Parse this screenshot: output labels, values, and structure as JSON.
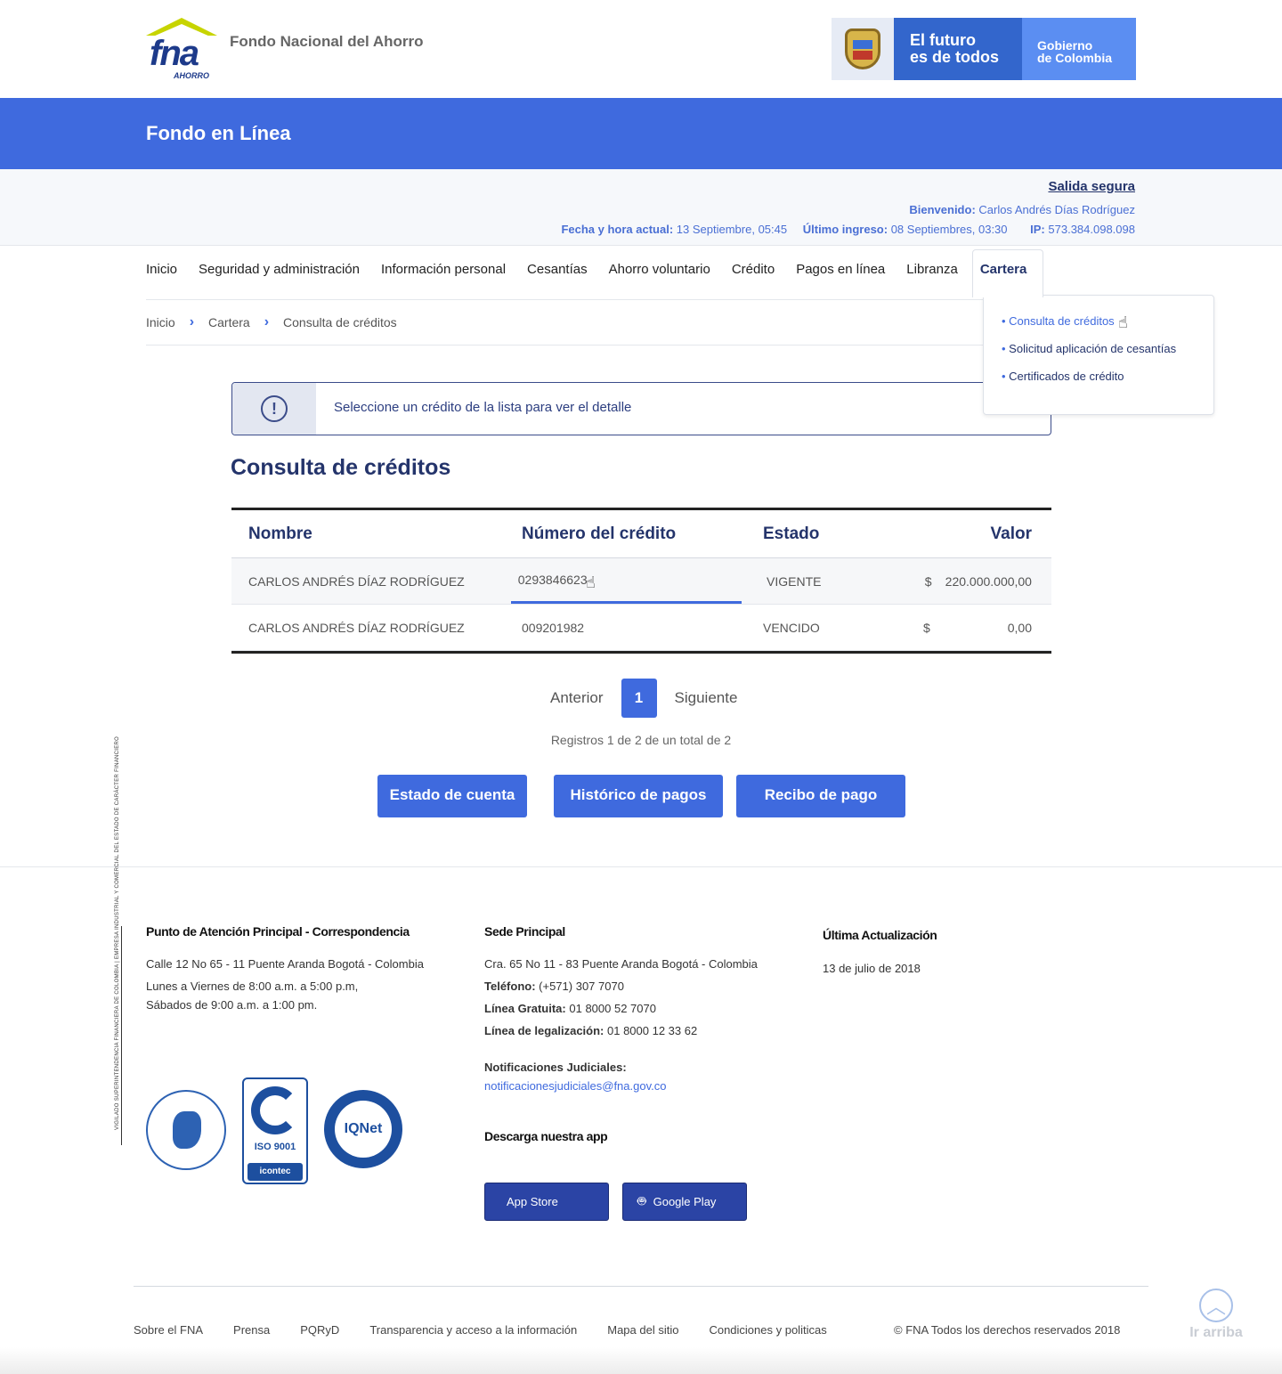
{
  "header": {
    "logo_text": "fna",
    "logo_sub": "AHORRO",
    "brand_name": "Fondo Nacional del Ahorro",
    "gov_slogan": "El futuro es de todos",
    "gov_slogan_l1": "El futuro",
    "gov_slogan_l2": "es de todos",
    "gov_name_l1": "Gobierno",
    "gov_name_l2": "de Colombia"
  },
  "bluebar": {
    "title": "Fondo en Línea"
  },
  "userbar": {
    "logout": "Salida segura",
    "welcome_label": "Bienvenido:",
    "welcome_name": "Carlos Andrés Días Rodríguez",
    "datetime_label": "Fecha y hora actual:",
    "datetime_value": "13 Septiembre, 05:45",
    "last_login_label": "Último ingreso:",
    "last_login_value": "08 Septiembres, 03:30",
    "ip_label": "IP:",
    "ip_value": "573.384.098.098"
  },
  "nav": {
    "items": [
      "Inicio",
      "Seguridad y administración",
      "Información personal",
      "Cesantías",
      "Ahorro voluntario",
      "Crédito",
      "Pagos en línea",
      "Libranza",
      "Cartera"
    ]
  },
  "dropdown": {
    "items": [
      "Consulta de créditos",
      "Solicitud aplicación de cesantías",
      "Certificados de crédito"
    ]
  },
  "breadcrumb": [
    "Inicio",
    "Cartera",
    "Consulta de créditos"
  ],
  "alert": {
    "message": "Seleccione un crédito de la lista para ver el detalle"
  },
  "page_title": "Consulta de créditos",
  "table": {
    "headers": [
      "Nombre",
      "Número del crédito",
      "Estado",
      "Valor"
    ],
    "rows": [
      {
        "nombre": "CARLOS ANDRÉS DÍAZ RODRÍGUEZ",
        "numero": "0293846623",
        "estado": "VIGENTE",
        "moneda": "$",
        "valor": "220.000.000,00"
      },
      {
        "nombre": "CARLOS ANDRÉS DÍAZ RODRÍGUEZ",
        "numero": "009201982",
        "estado": "VENCIDO",
        "moneda": "$",
        "valor": "0,00"
      }
    ]
  },
  "pagination": {
    "prev": "Anterior",
    "current": "1",
    "next": "Siguiente",
    "summary": "Registros 1 de 2 de un total de 2"
  },
  "actions": {
    "estado": "Estado de cuenta",
    "historico": "Histórico de pagos",
    "recibo": "Recibo de pago"
  },
  "footer": {
    "vigilado": "VIGILADO SUPERINTENDENCIA FINANCIERA DE COLOMBIA | EMPRESA INDUSTRIAL Y COMERCIAL DEL ESTADO DE CARÁCTER FINANCIERO",
    "col1_title": "Punto de Atención Principal - Correspondencia",
    "col1_address": "Calle 12 No 65 - 11 Puente Aranda Bogotá - Colombia",
    "col1_hours1": "Lunes a Viernes de 8:00 a.m. a 5:00 p.m,",
    "col1_hours2": "Sábados de 9:00 a.m. a 1:00 pm.",
    "col2_title": "Sede Principal",
    "col2_address": "Cra. 65 No 11 - 83 Puente Aranda Bogotá - Colombia",
    "phone_label": "Teléfono:",
    "phone_value": "(+571) 307 7070",
    "free_label": "Línea Gratuita:",
    "free_value": "01 8000 52 7070",
    "legal_label": "Línea de legalización:",
    "legal_value": "01 8000 12 33 62",
    "notif_label": "Notificaciones Judiciales:",
    "notif_email": "notificacionesjudiciales@fna.gov.co",
    "app_title": "Descarga nuestra app",
    "app_store": "App Store",
    "google_play": "Google Play",
    "col3_title": "Última Actualización",
    "col3_date": "13 de julio de 2018",
    "cert_iso": "ISO 9001",
    "cert_icontec": "icontec",
    "cert_iqnet": "IQNet",
    "links": [
      "Sobre el FNA",
      "Prensa",
      "PQRyD",
      "Transparencia y acceso a la información",
      "Mapa del sitio",
      "Condiciones y politicas"
    ],
    "copyright": "FNA Todos los derechos reservados 2018",
    "to_top": "Ir arriba"
  },
  "colors": {
    "primary": "#3f6ade",
    "navy": "#24346b",
    "lime": "#c7d400",
    "gov_blue": "#3366cc"
  }
}
